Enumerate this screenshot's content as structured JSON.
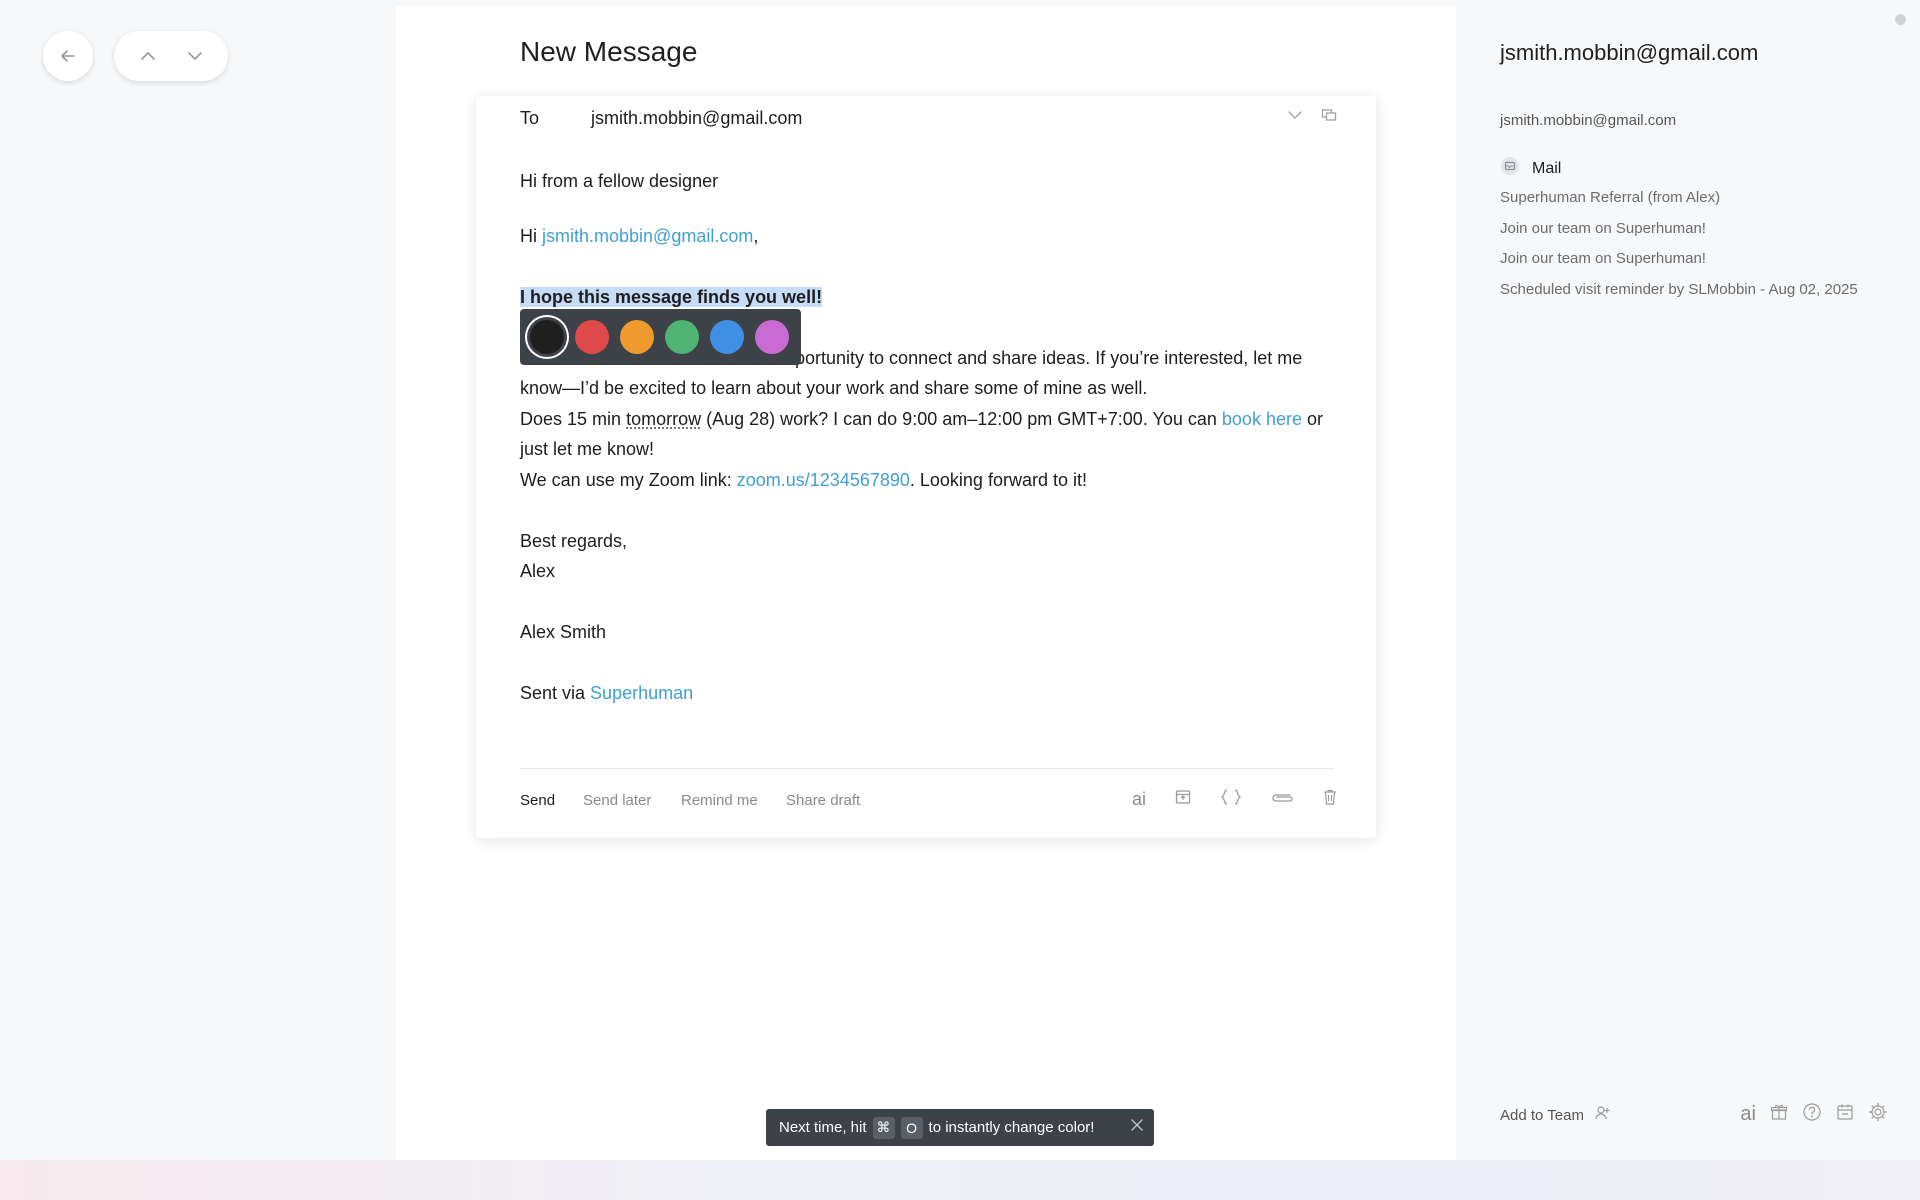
{
  "page": {
    "title": "New Message"
  },
  "compose": {
    "to_label": "To",
    "to_value": "jsmith.mobbin@gmail.com",
    "subject": "Hi from a fellow designer",
    "greeting_prefix": "Hi ",
    "greeting_email": "jsmith.mobbin@gmail.com",
    "greeting_suffix": ",",
    "highlighted_line": "I hope this message finds you well!",
    "para1_visible": "portunity to connect and share ideas. If you’re interested, let me",
    "para1_line2": "know—I’d be excited to learn about your work and share some of mine as well.",
    "para2_a": " Does 15 min ",
    "para2_tomorrow": "tomorrow",
    "para2_b": " (Aug 28) work? I can do 9:00 am–12:00 pm GMT+7:00. You can ",
    "para2_link": "book here",
    "para2_c": " or",
    "para2_line2": "just let me know!",
    "para3_a": "We can use my Zoom link: ",
    "para3_link": "zoom.us/1234567890",
    "para3_b": ". Looking forward to it!",
    "signoff": "Best regards,",
    "signoff_name": "Alex",
    "signature_name": "Alex Smith",
    "sent_via_prefix": "Sent via ",
    "sent_via_link": "Superhuman"
  },
  "color_picker": {
    "colors": [
      "#1f1f1f",
      "#e0484a",
      "#ef9a2e",
      "#4fb374",
      "#3f8fe5",
      "#c96bd2"
    ],
    "selected_index": 0
  },
  "toolbar": {
    "send": "Send",
    "send_later": "Send later",
    "remind_me": "Remind me",
    "share_draft": "Share draft",
    "ai_label": "ai"
  },
  "contact": {
    "name": "jsmith.mobbin@gmail.com",
    "email": "jsmith.mobbin@gmail.com",
    "mail_header": "Mail",
    "mail_items": [
      "Superhuman Referral (from Alex)",
      "Join our team on Superhuman!",
      "Join our team on Superhuman!",
      "Scheduled visit reminder by SLMobbin - Aug 02, 2025"
    ],
    "add_to_team": "Add to Team",
    "ai_label": "ai"
  },
  "toast": {
    "prefix": "Next time, hit",
    "key1": "⌘",
    "key2": "O",
    "suffix": "to instantly change color!"
  },
  "colors": {
    "accent_link": "#3fa0d6",
    "highlight": "#c7dcf6",
    "dark_surface": "#3d4148"
  }
}
